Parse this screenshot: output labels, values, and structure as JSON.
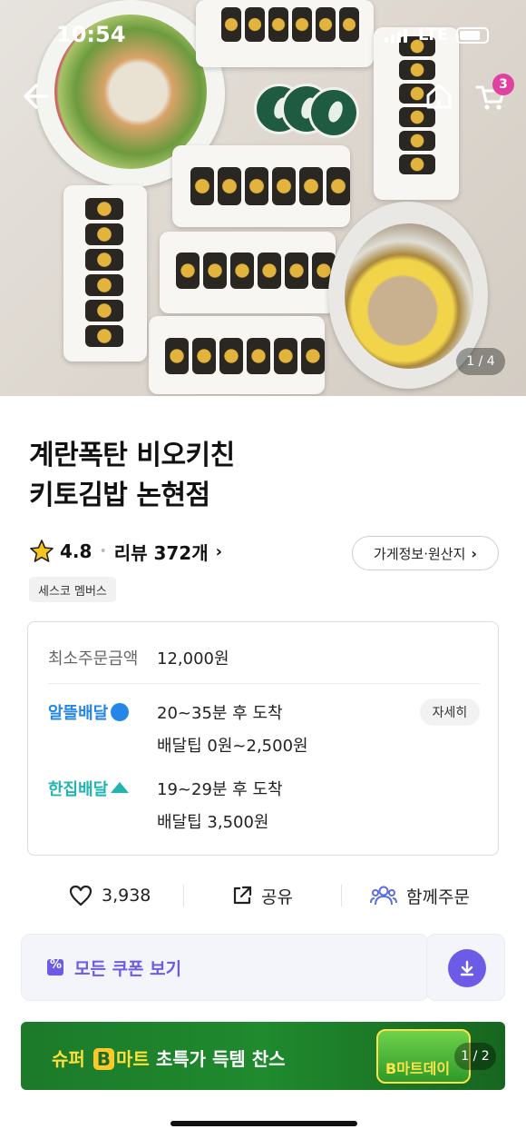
{
  "status_bar": {
    "time": "10:54",
    "network": "LTE"
  },
  "header": {
    "cart_count": "3"
  },
  "hero": {
    "pager": "1 / 4"
  },
  "store": {
    "title_line1": "계란폭탄 비오키친",
    "title_line2": "키토김밥 논현점",
    "rating": "4.8",
    "review_label": "리뷰 372개",
    "info_button": "가게정보·원산지",
    "member_tag": "세스코 멤버스"
  },
  "delivery": {
    "min_order_label": "최소주문금액",
    "min_order_value": "12,000원",
    "options": [
      {
        "name": "알뜰배달",
        "time": "20~35분 후 도착",
        "tip": "배달팁 0원~2,500원"
      },
      {
        "name": "한집배달",
        "time": "19~29분 후 도착",
        "tip": "배달팁 3,500원"
      }
    ],
    "detail_button": "자세히"
  },
  "actions": {
    "like_count": "3,938",
    "share": "공유",
    "group_order": "함께주문"
  },
  "coupon": {
    "label": "모든 쿠폰 보기"
  },
  "banner": {
    "text_part1": "슈퍼",
    "text_b": "B",
    "text_part2": "마트",
    "text_part3": "초특가 득템 찬스",
    "art_text": "B마트데이",
    "pager": "1 / 2"
  },
  "colors": {
    "accent": "#6b5be6",
    "alddle": "#2486e8",
    "hanjip": "#20b5b0",
    "badge": "#e0409f"
  }
}
